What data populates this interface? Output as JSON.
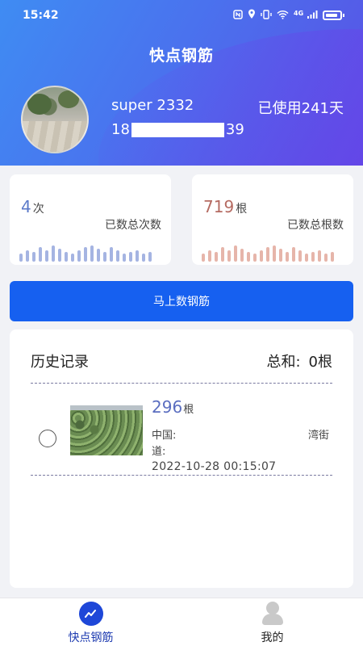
{
  "status_bar": {
    "time": "15:42",
    "network": "4G",
    "icons": [
      "nfc-icon",
      "location-icon",
      "vibrate-icon",
      "wifi-icon",
      "signal-icon",
      "battery-icon"
    ]
  },
  "header": {
    "title": "快点钢筋",
    "username": "super 2332",
    "phone_prefix": "18",
    "phone_suffix": "39",
    "usage_text": "已使用241天"
  },
  "stats": {
    "count": {
      "value": "4",
      "unit": "次",
      "label": "已数总次数",
      "bar_color": "#a5b4e2"
    },
    "bars": {
      "value": "719",
      "unit": "根",
      "label": "已数总根数",
      "bar_color": "#e6b5aa"
    }
  },
  "cta": {
    "label": "马上数钢筋"
  },
  "history": {
    "title": "历史记录",
    "total_label": "总和:",
    "total_value": "0根",
    "records": [
      {
        "count": "296",
        "unit": "根",
        "address_line1_start": "中国:",
        "address_line1_end": "湾街",
        "address_line2": "道:",
        "datetime": "2022-10-28 00:15:07"
      }
    ]
  },
  "tabbar": {
    "tabs": [
      {
        "label": "快点钢筋",
        "icon": "trend-chart-icon",
        "active": true
      },
      {
        "label": "我的",
        "icon": "user-icon",
        "active": false
      }
    ]
  },
  "colors": {
    "primary": "#1660f0",
    "header_start": "#3f8cf3",
    "header_end": "#5a50e4",
    "count_accent": "#5b7ac9",
    "bars_accent": "#b56b62"
  }
}
